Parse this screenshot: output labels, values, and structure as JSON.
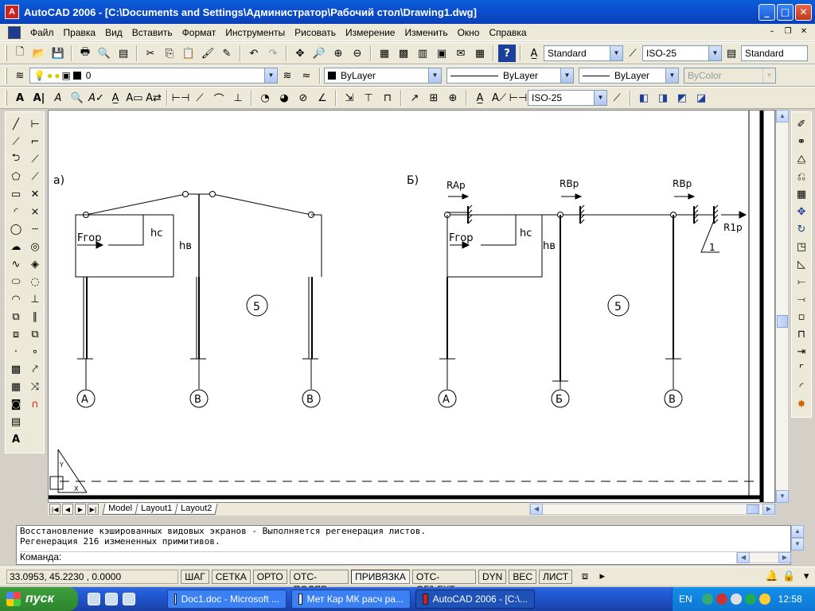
{
  "window": {
    "title": "AutoCAD 2006 - [C:\\Documents and Settings\\Администратор\\Рабочий стол\\Drawing1.dwg]",
    "app_icon": "A"
  },
  "menu": [
    "Файл",
    "Правка",
    "Вид",
    "Вставить",
    "Формат",
    "Инструменты",
    "Рисовать",
    "Измерение",
    "Изменить",
    "Окно",
    "Справка"
  ],
  "toolbar_standard": {
    "text_style": "Standard",
    "dim_style": "ISO-25",
    "table_style": "Standard"
  },
  "toolbar_layers": {
    "layer_name": "0",
    "color": "ByLayer",
    "linetype": "ByLayer",
    "lineweight": "ByLayer",
    "plot_style": "ByColor"
  },
  "toolbar_dims": {
    "dim_style": "ISO-25"
  },
  "drawing": {
    "left": {
      "label": "а)",
      "force": "Fгор",
      "hc": "hc",
      "hb": "hв",
      "span_label": "5",
      "axes": [
        "А",
        "В",
        "В"
      ]
    },
    "right": {
      "label": "Б)",
      "force": "Fгор",
      "hc": "hc",
      "hb": "hв",
      "span_label": "5",
      "reactions": [
        "RAр",
        "RBр",
        "RBр"
      ],
      "r1": "R1р",
      "support_label": "1",
      "axes": [
        "А",
        "Б",
        "В"
      ]
    }
  },
  "layout_tabs": [
    "Model",
    "Layout1",
    "Layout2"
  ],
  "command": {
    "lines": [
      "Восстановление кэшированных видовых экранов - Выполняется регенерация листов.",
      "Регенерация 216 измененных примитивов."
    ],
    "prompt": "Команда:"
  },
  "status": {
    "coords": "33.0953, 45.2230 , 0.0000",
    "buttons": [
      "ШАГ",
      "СЕТКА",
      "ОРТО",
      "ОТС-ПОЛЯР",
      "ПРИВЯЗКА",
      "ОТС-ОБЪЕКТ",
      "DYN",
      "ВЕС",
      "ЛИСТ"
    ]
  },
  "taskbar": {
    "start": "пуск",
    "tasks": [
      "Doc1.doc - Microsoft ...",
      "Мет Кар МК расч ра...",
      "AutoCAD 2006 - [C:\\..."
    ],
    "lang": "EN",
    "clock": "12:58"
  }
}
